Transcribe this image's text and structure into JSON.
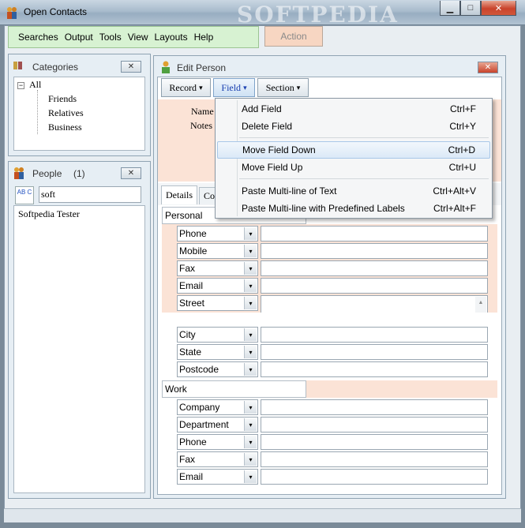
{
  "window": {
    "title": "Open Contacts",
    "watermark": "SOFTPEDIA",
    "minimize": "▁",
    "maximize": "□",
    "close": "✕"
  },
  "menubar": {
    "items": [
      "Searches",
      "Output",
      "Tools",
      "View",
      "Layouts",
      "Help"
    ]
  },
  "action_button": "Action",
  "categories": {
    "title": "Categories",
    "close": "✕",
    "expander": "−",
    "root": "All",
    "children": [
      "Friends",
      "Relatives",
      "Business"
    ]
  },
  "people": {
    "title": "People",
    "count": "(1)",
    "close": "✕",
    "search_value": "soft",
    "sort_icon_text": "AB C",
    "results": [
      "Softpedia Tester"
    ]
  },
  "edit_person": {
    "title": "Edit Person",
    "close": "✕",
    "toolbar": {
      "record": "Record",
      "field": "Field",
      "section": "Section",
      "arrow": "▾"
    },
    "labels": {
      "name": "Name",
      "notes": "Notes"
    },
    "tabs": [
      "Details",
      "Co"
    ],
    "sections": [
      {
        "title": "Personal",
        "fields": [
          "Phone",
          "Mobile",
          "Fax",
          "Email",
          "Street",
          "City",
          "State",
          "Postcode"
        ]
      },
      {
        "title": "Work",
        "fields": [
          "Company",
          "Department",
          "Phone",
          "Fax",
          "Email"
        ]
      }
    ]
  },
  "field_menu": {
    "groups": [
      [
        {
          "label": "Add Field",
          "shortcut": "Ctrl+F"
        },
        {
          "label": "Delete Field",
          "shortcut": "Ctrl+Y"
        }
      ],
      [
        {
          "label": "Move Field Down",
          "shortcut": "Ctrl+D"
        },
        {
          "label": "Move Field Up",
          "shortcut": "Ctrl+U"
        }
      ],
      [
        {
          "label": "Paste Multi-line of Text",
          "shortcut": "Ctrl+Alt+V"
        },
        {
          "label": "Paste Multi-line with Predefined Labels",
          "shortcut": "Ctrl+Alt+F"
        }
      ]
    ]
  },
  "colors": {
    "menubar_bg": "#d7f2d2",
    "form_bg": "#fbe3d6",
    "highlight": "#dbe9f7"
  },
  "icons": {
    "app": "people-icon",
    "combo_arrow": "▾"
  }
}
